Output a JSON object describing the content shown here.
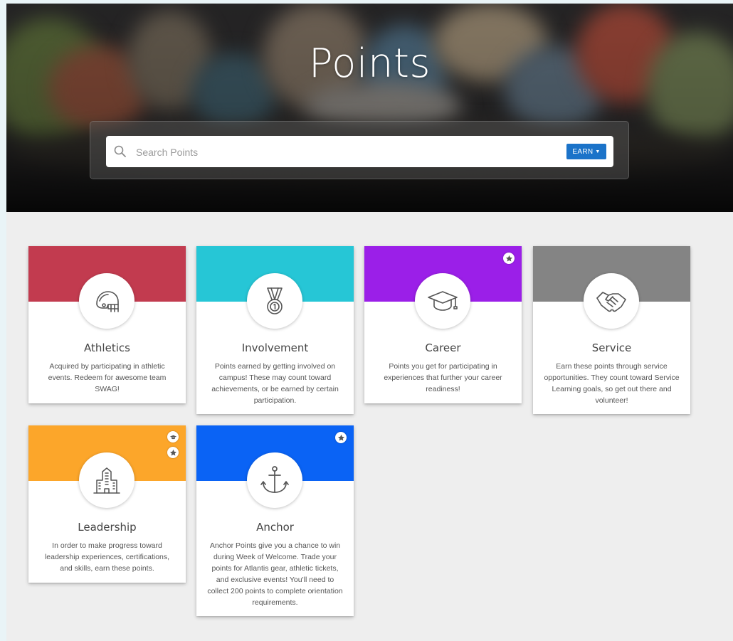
{
  "header": {
    "title": "Points"
  },
  "search": {
    "placeholder": "Search Points",
    "earn_label": "EARN"
  },
  "colors": {
    "athletics": "#c23b4f",
    "involvement": "#26c6d6",
    "career": "#9b1fe8",
    "service": "#848484",
    "leadership": "#fca62a",
    "anchor": "#0a63f5",
    "earn_button": "#1b73c9"
  },
  "cards": [
    {
      "title": "Athletics",
      "icon": "football-helmet-icon",
      "description": "Acquired by participating in athletic events. Redeem for awesome team SWAG!",
      "badges": []
    },
    {
      "title": "Involvement",
      "icon": "medal-icon",
      "description": "Points earned by getting involved on campus! These may count toward achievements, or be earned by certain participation.",
      "badges": []
    },
    {
      "title": "Career",
      "icon": "graduation-cap-icon",
      "description": "Points you get for participating in experiences that further your career readiness!",
      "badges": [
        "star-icon"
      ]
    },
    {
      "title": "Service",
      "icon": "handshake-icon",
      "description": "Earn these points through service opportunities. They count toward Service Learning goals, so get out there and volunteer!",
      "badges": []
    },
    {
      "title": "Leadership",
      "icon": "building-icon",
      "description": "In order to make progress toward leadership experiences, certifications, and skills, earn these points.",
      "badges": [
        "graduation-cap-icon",
        "star-icon"
      ]
    },
    {
      "title": "Anchor",
      "icon": "anchor-icon",
      "description": "Anchor Points give you a chance to win during Week of Welcome. Trade your points for Atlantis gear, athletic tickets, and exclusive events! You'll need to collect 200 points to complete orientation requirements.",
      "badges": [
        "star-icon"
      ]
    }
  ]
}
